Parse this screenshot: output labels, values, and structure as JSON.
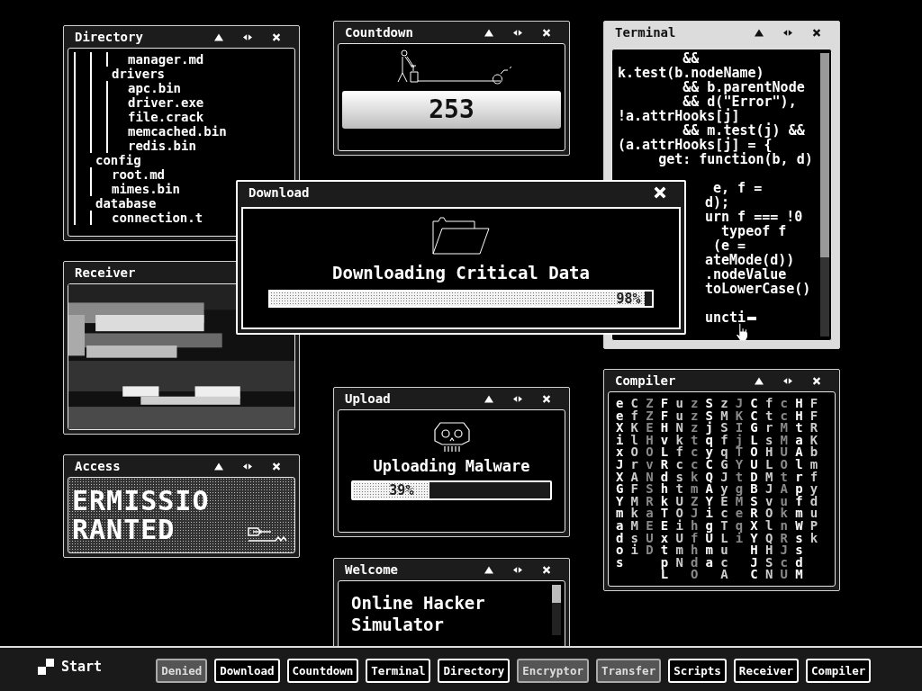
{
  "directory": {
    "title": "Directory",
    "tree": [
      {
        "children": [
          {
            "children": [
              {
                "name": "manager.md"
              }
            ]
          },
          {
            "name": "drivers",
            "children": [
              {
                "name": "apc.bin"
              },
              {
                "name": "driver.exe"
              },
              {
                "name": "file.crack"
              },
              {
                "name": "memcached.bin"
              },
              {
                "name": "redis.bin"
              }
            ]
          }
        ]
      },
      {
        "name": "config",
        "children": [
          {
            "name": "root.md"
          },
          {
            "name": "mimes.bin"
          }
        ]
      },
      {
        "name": "database",
        "children": [
          {
            "name": "connection.t"
          }
        ]
      }
    ]
  },
  "countdown": {
    "title": "Countdown",
    "value": "253"
  },
  "terminal": {
    "title": "Terminal",
    "lines": [
      {
        "text": "        &&",
        "kind": "full"
      },
      {
        "text": "k.test(b.nodeName)",
        "kind": "full"
      },
      {
        "text": "        && b.parentNode",
        "kind": "full"
      },
      {
        "text": "        && d(\"Error\"),",
        "kind": "full"
      },
      {
        "text": "!a.attrHooks[j]",
        "kind": "full"
      },
      {
        "text": "        && m.test(j) &&",
        "kind": "full"
      },
      {
        "text": "(a.attrHooks[j] = {",
        "kind": "full"
      },
      {
        "text": "     get: function(b, d)",
        "kind": "full"
      },
      {
        "text": " e, f =",
        "kind": "clipped"
      },
      {
        "text": "d);",
        "kind": "clipped"
      },
      {
        "text": "urn f === !0",
        "kind": "clipped"
      },
      {
        "text": "  typeof f",
        "kind": "clipped"
      },
      {
        "text": " (e =",
        "kind": "clipped"
      },
      {
        "text": "ateMode(d))",
        "kind": "clipped"
      },
      {
        "text": ".nodeValue",
        "kind": "clipped"
      },
      {
        "text": "toLowerCase()",
        "kind": "clipped"
      }
    ],
    "input": "uncti"
  },
  "receiver": {
    "title": "Receiver"
  },
  "download": {
    "title": "Download",
    "message": "Downloading Critical Data",
    "level": 0.98,
    "reading": "98%"
  },
  "compiler": {
    "title": "Compiler",
    "columns": [
      "eeXixJXGYmados",
      "CfKlOrAFMkMsi",
      "ZZEHOvNSRaEUD",
      "FFHvLRdhkTExtpL",
      "uuNkfcstUOiUmN",
      "zzztcckmZJhfhdO",
      "SSjqyCQAYigUma",
      "zMSfqGJyEcTLucA",
      "JKIjTYtgMeqi",
      "CCGLOUDBSRXYHJC",
      "ftrsHLMJvOlQHSN",
      "ccMMUOtAuknRJcU",
      "HHtaAlrpfmWssdM",
      "FFRKbmfyduPk"
    ]
  },
  "access": {
    "title": "Access",
    "lines": [
      "ERMISSIO",
      "RANTED"
    ]
  },
  "upload": {
    "title": "Upload",
    "message": "Uploading Malware",
    "level": 0.39,
    "reading": "39%"
  },
  "welcome": {
    "title": "Welcome",
    "heading": "Online Hacker Simulator"
  },
  "taskbar": {
    "start": "Start",
    "buttons": [
      {
        "label": "Denied",
        "minimized": true
      },
      {
        "label": "Download",
        "minimized": false
      },
      {
        "label": "Countdown",
        "minimized": false
      },
      {
        "label": "Terminal",
        "minimized": false
      },
      {
        "label": "Directory",
        "minimized": false
      },
      {
        "label": "Encryptor",
        "minimized": true
      },
      {
        "label": "Transfer",
        "minimized": true
      },
      {
        "label": "Scripts",
        "minimized": false
      },
      {
        "label": "Receiver",
        "minimized": false
      },
      {
        "label": "Compiler",
        "minimized": false
      }
    ]
  }
}
